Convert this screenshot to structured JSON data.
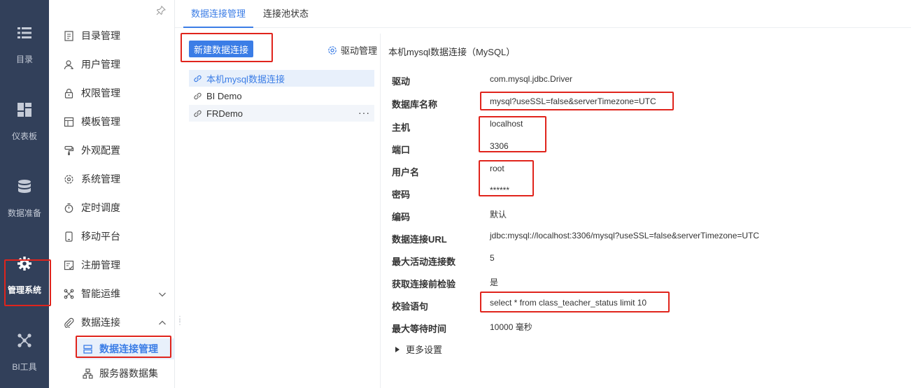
{
  "rail": {
    "items": [
      {
        "label": "目录",
        "icon": "list-icon"
      },
      {
        "label": "仪表板",
        "icon": "dashboard-icon"
      },
      {
        "label": "数据准备",
        "icon": "database-icon"
      },
      {
        "label": "管理系统",
        "icon": "gear-icon"
      },
      {
        "label": "BI工具",
        "icon": "network-icon"
      }
    ]
  },
  "menu": {
    "items": [
      {
        "label": "目录管理"
      },
      {
        "label": "用户管理"
      },
      {
        "label": "权限管理"
      },
      {
        "label": "模板管理"
      },
      {
        "label": "外观配置"
      },
      {
        "label": "系统管理"
      },
      {
        "label": "定时调度"
      },
      {
        "label": "移动平台"
      },
      {
        "label": "注册管理"
      },
      {
        "label": "智能运维"
      },
      {
        "label": "数据连接"
      }
    ],
    "sub_items": [
      {
        "label": "数据连接管理"
      },
      {
        "label": "服务器数据集"
      }
    ]
  },
  "tabs": [
    {
      "label": "数据连接管理"
    },
    {
      "label": "连接池状态"
    }
  ],
  "list": {
    "new_button": "新建数据连接",
    "driver_manage": "驱动管理",
    "connections": [
      {
        "name": "本机mysql数据连接"
      },
      {
        "name": "BI Demo"
      },
      {
        "name": "FRDemo"
      }
    ],
    "more_glyph": "···"
  },
  "detail": {
    "title": "本机mysql数据连接（MySQL）",
    "fields": [
      {
        "label": "驱动",
        "value": "com.mysql.jdbc.Driver"
      },
      {
        "label": "数据库名称",
        "value": "mysql?useSSL=false&serverTimezone=UTC"
      },
      {
        "label": "主机",
        "value": "localhost"
      },
      {
        "label": "端口",
        "value": "3306"
      },
      {
        "label": "用户名",
        "value": "root"
      },
      {
        "label": "密码",
        "value": "******"
      },
      {
        "label": "编码",
        "value": "默认"
      },
      {
        "label": "数据连接URL",
        "value": "jdbc:mysql://localhost:3306/mysql?useSSL=false&serverTimezone=UTC"
      },
      {
        "label": "最大活动连接数",
        "value": "5"
      },
      {
        "label": "获取连接前检验",
        "value": "是"
      },
      {
        "label": "校验语句",
        "value": "select * from class_teacher_status limit 10"
      },
      {
        "label": "最大等待时间",
        "value": "10000 毫秒"
      }
    ],
    "more_settings": "更多设置"
  },
  "colors": {
    "rail_bg": "#32405a",
    "accent": "#3b7de6",
    "selected_bg": "#e8f0fb",
    "annotation": "#e0241c"
  }
}
